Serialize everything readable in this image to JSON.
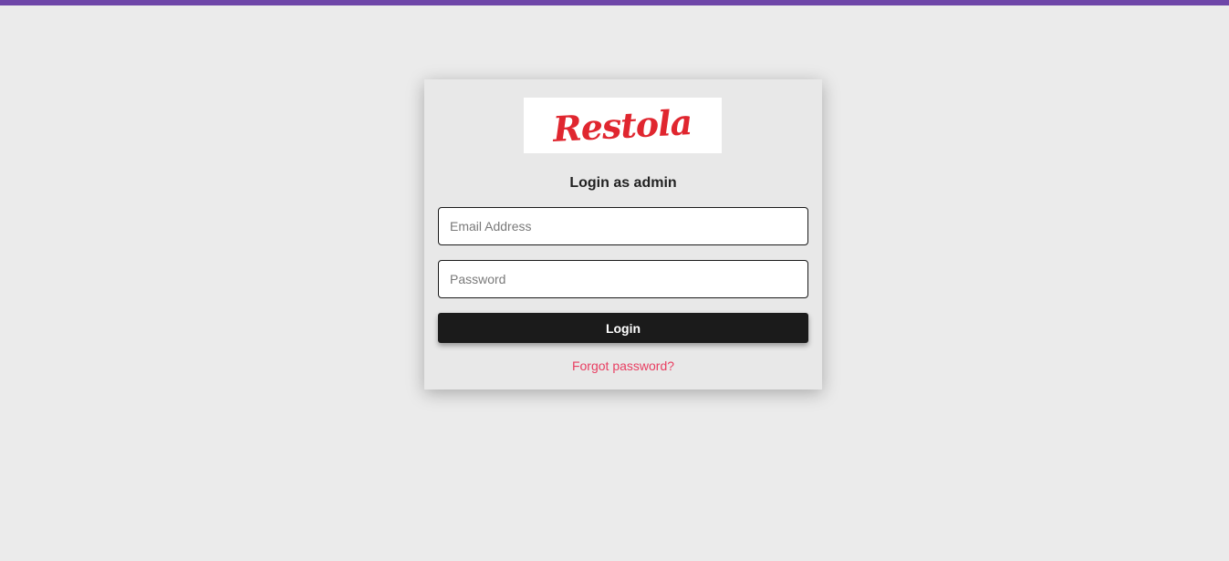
{
  "brand": {
    "logo_text": "Restola",
    "logo_color": "#e0262f",
    "top_bar_color": "#6e46a8"
  },
  "login": {
    "heading": "Login as admin",
    "email_placeholder": "Email Address",
    "email_value": "",
    "password_placeholder": "Password",
    "password_value": "",
    "submit_label": "Login",
    "forgot_label": "Forgot password?"
  }
}
